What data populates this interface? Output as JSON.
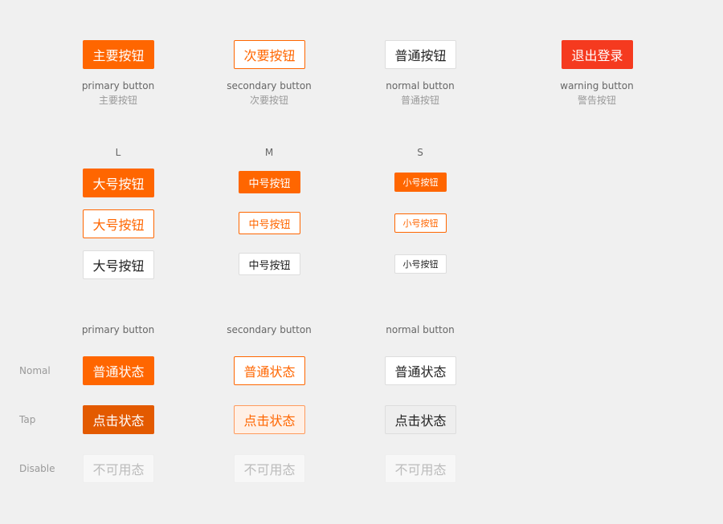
{
  "types": [
    {
      "label": "主要按钮",
      "en": "primary button",
      "zh": "主要按钮"
    },
    {
      "label": "次要按钮",
      "en": "secondary button",
      "zh": "次要按钮"
    },
    {
      "label": "普通按钮",
      "en": "normal button",
      "zh": "普通按钮"
    },
    {
      "label": "退出登录",
      "en": "warning button",
      "zh": "警告按钮"
    }
  ],
  "sizes": {
    "labels": [
      "L",
      "M",
      "S"
    ],
    "large": "大号按钮",
    "medium": "中号按钮",
    "small": "小号按钮"
  },
  "states": {
    "columns": [
      "primary button",
      "secondary button",
      "normal button"
    ],
    "rows": [
      "Nomal",
      "Tap",
      "Disable"
    ],
    "normal_text": "普通状态",
    "tap_text": "点击状态",
    "disabled_text": "不可用态"
  },
  "colors": {
    "primary": "#ff6600",
    "primary_tap": "#e35a00",
    "warning": "#f53a1f",
    "secondary_tap_bg": "#fff0e6",
    "background": "#f0f0f0"
  }
}
